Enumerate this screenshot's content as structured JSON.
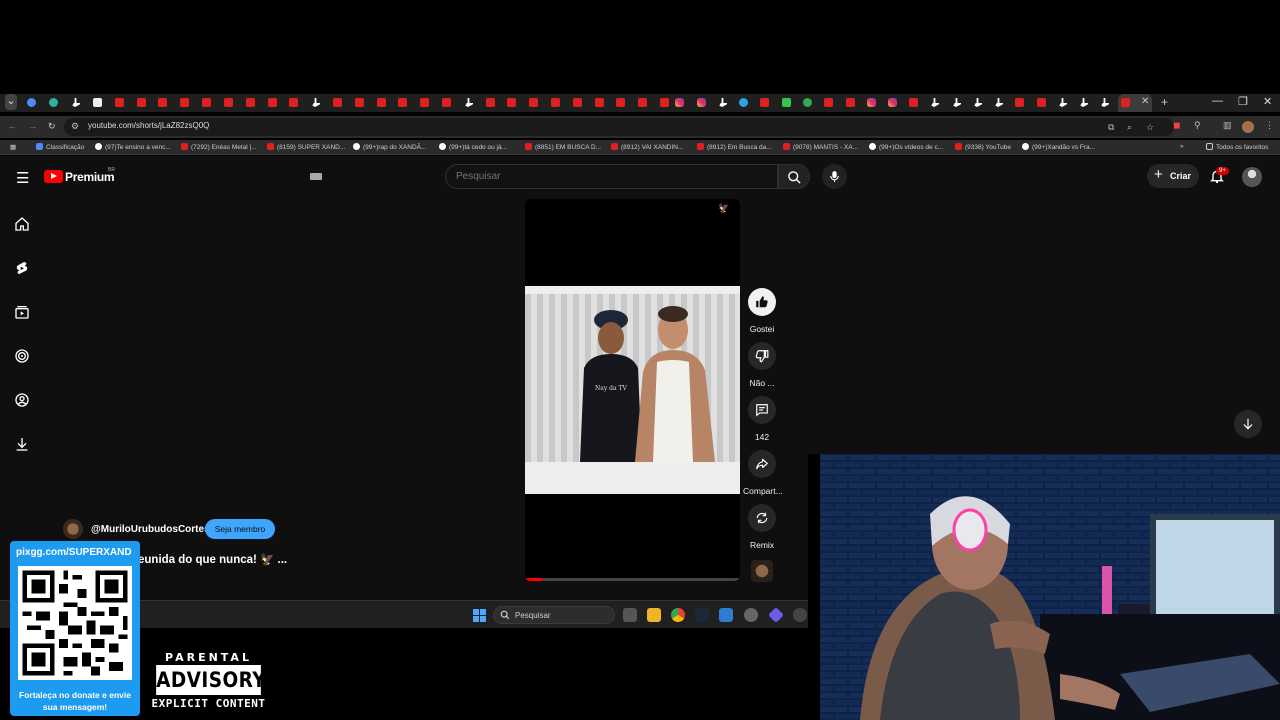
{
  "browser": {
    "url": "youtube.com/shorts/jLaZ82zsQ0Q",
    "bookmarks": [
      "Classificação",
      "(97)Te ensino a venc...",
      "(7292) Enéas Metal |...",
      "(8159) SUPER XAND...",
      "(99+)rap do XANDÃ...",
      "(99+)tá cedo ou já...",
      "(8851) EM BUSCA D...",
      "(8912) VAI XANDIN...",
      "(8912) Em Busca da...",
      "(9078) MANTIS - XA...",
      "(99+)Os vídeos de c...",
      "(9338) YouTube",
      "(99+)Xandão vs Fra..."
    ],
    "all_bookmarks_label": "Todos os favoritos"
  },
  "youtube": {
    "brand": "Premium",
    "country": "BR",
    "search_placeholder": "Pesquisar",
    "create_label": "Criar",
    "notification_badge": "9+",
    "actions": {
      "like": "Gostei",
      "dislike": "Não ...",
      "comments": "142",
      "share": "Compart...",
      "remix": "Remix"
    },
    "short": {
      "channel": "@MuriloUrubudosCortes",
      "member_button": "Seja membro",
      "title": "eunida do que nunca! 🦅 ...",
      "shirt_text": "Nay da TV",
      "progress": 0.08
    }
  },
  "taskbar": {
    "search_label": "Pesquisar"
  },
  "overlay": {
    "donate_url": "pixgg.com/SUPERXAND",
    "donate_message": "Fortaleça no donate e envie sua mensagem!",
    "advisory": {
      "top": "PARENTAL",
      "middle": "ADVISORY",
      "bottom": "EXPLICIT CONTENT"
    }
  },
  "colors": {
    "youtube_red": "#ff0000",
    "member_blue": "#3ea6ff",
    "donate_blue": "#1d9bf0",
    "background": "#0f0f0f"
  }
}
